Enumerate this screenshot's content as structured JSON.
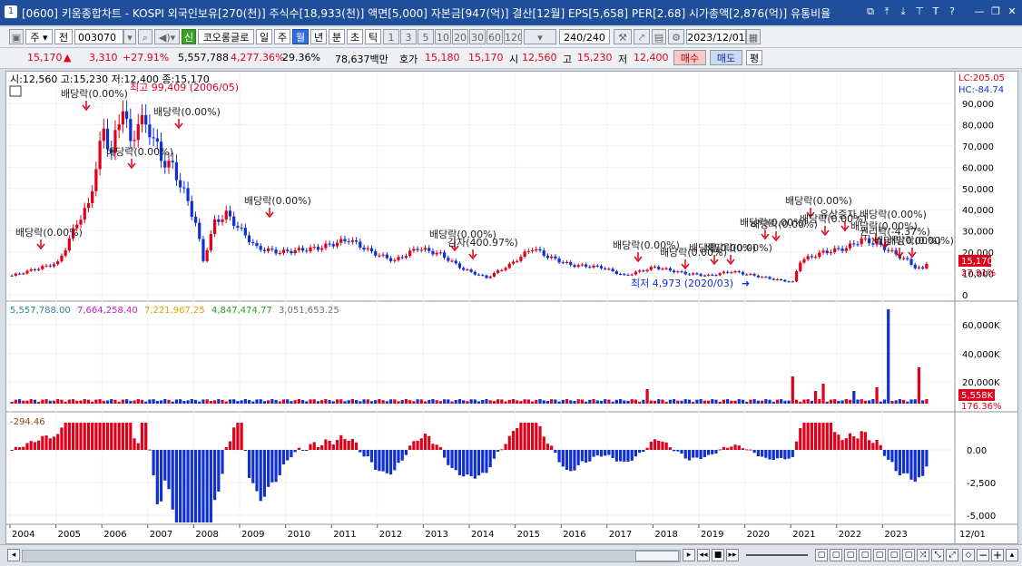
{
  "window": {
    "number": "1",
    "title": "[0600] 키움종합차트 - KOSPI 외국인보유[270(천)] 주식수[18,933(천)] 액면[5,000] 자본금[947(억)] 결산[12월] EPS[5,658] PER[2.68] 시가총액[2,876(억)] 유통비율"
  },
  "toolbar": {
    "type_select": "주",
    "prev_btn": "전",
    "code": "003070",
    "badge": "신",
    "stock_name": "코오롱글로",
    "periods": [
      "일",
      "주",
      "월",
      "년",
      "분",
      "초",
      "틱"
    ],
    "selected_period": "월",
    "intervals": [
      "1",
      "3",
      "5",
      "10",
      "20",
      "30",
      "60",
      "120"
    ],
    "count": "240/240",
    "date": "2023/12/01"
  },
  "quote": {
    "price": "15,170",
    "change": "3,310",
    "change_pct": "+27.91%",
    "volume": "5,557,788",
    "vol_ratio": "4,277.36%",
    "turnover": "29.36%",
    "amount": "78,637백만",
    "bid_label": "호가",
    "bid": "15,180",
    "ask": "15,170",
    "open_label": "시",
    "open": "12,560",
    "high_label": "고",
    "high": "15,230",
    "low_label": "저",
    "low": "12,400",
    "buy": "매수",
    "sell": "매도",
    "eval": "평"
  },
  "chart": {
    "ohlc_text": "시:12,560 고:15,230 저:12,400 종:15,170",
    "lc": "LC:205.05",
    "hc": "HC:-84.74",
    "price_ticks": [
      "90,000",
      "80,000",
      "70,000",
      "60,000",
      "50,000",
      "40,000",
      "30,000",
      "20,000",
      "10,000",
      "0"
    ],
    "last_price": "15,170",
    "last_pct": "27.91%",
    "max_label": "최고 99,409 (2006/05)",
    "min_label": "최저 4,973 (2020/03)",
    "annotations": [
      "배당락(0.00%)",
      "배당락(0.00%)",
      "배당락(0.00%)",
      "배당락(0.00%)",
      "배당락(0.00%)",
      "배당락(0.00%)",
      "감자(400.97%)",
      "배당락(0.00%)",
      "배당락(0.00%)",
      "배당락(0.00%)",
      "배당락(0.00%)",
      "배당락(0.00%)",
      "배당락(0.00%)",
      "배당락(0.00%)",
      "배당락(0.00%)",
      "유상증자,배당락(0.00%)",
      "배당락(0.00%)",
      "권리락(-4.37%)",
      "배당락(0.00%)",
      "배당락(0.00%)"
    ],
    "volume_legend": [
      "5,557,788.00",
      "7,664,258.40",
      "7,221,967.25",
      "4,847,474.77",
      "3,051,653.25"
    ],
    "volume_legend_colors": [
      "#2e8b8b",
      "#c020c0",
      "#e0a000",
      "#20a020",
      "#707070"
    ],
    "volume_ticks": [
      "60,000K",
      "40,000K",
      "20,000K"
    ],
    "last_volume": "5,558K",
    "last_vol_pct": "176.36%",
    "osc_value": "-294.46",
    "osc_ticks": [
      "0.00",
      "-2,500",
      "-5,000"
    ],
    "years": [
      "2004",
      "2005",
      "2006",
      "2007",
      "2008",
      "2009",
      "2010",
      "2011",
      "2012",
      "2013",
      "2014",
      "2015",
      "2016",
      "2017",
      "2018",
      "2019",
      "2020",
      "2021",
      "2022",
      "2023"
    ],
    "last_axis_label": "12/01"
  },
  "colors": {
    "up": "#e0001b",
    "down": "#1030d0",
    "title": "#1f4e9a"
  }
}
